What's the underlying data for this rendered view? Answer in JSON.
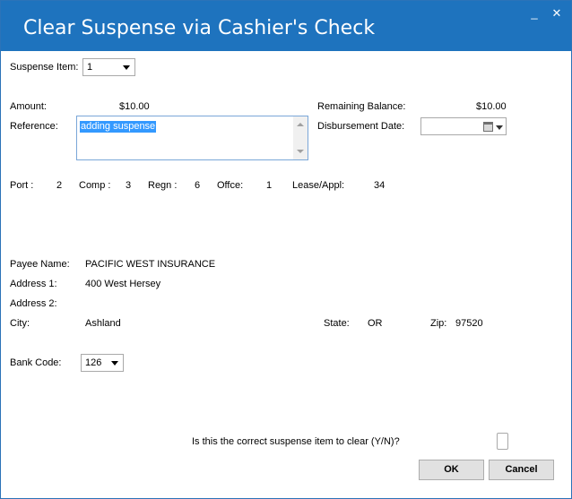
{
  "window": {
    "title": "Clear Suspense via Cashier's Check",
    "minimize_glyph": "_",
    "close_glyph": "✕",
    "titlebar_color": "#1e73be"
  },
  "suspense": {
    "label": "Suspense Item:",
    "value": "1"
  },
  "amount": {
    "label": "Amount:",
    "value": "$10.00"
  },
  "remaining": {
    "label": "Remaining Balance:",
    "value": "$10.00"
  },
  "reference": {
    "label": "Reference:",
    "value": "adding suspense"
  },
  "disbursement": {
    "label": "Disbursement Date:",
    "value": ""
  },
  "codes": {
    "port_label": "Port :",
    "port_value": "2",
    "comp_label": "Comp :",
    "comp_value": "3",
    "regn_label": "Regn :",
    "regn_value": "6",
    "office_label": "Offce:",
    "office_value": "1",
    "lease_label": "Lease/Appl:",
    "lease_value": "34"
  },
  "payee": {
    "name_label": "Payee Name:",
    "name_value": "PACIFIC WEST INSURANCE",
    "addr1_label": "Address 1:",
    "addr1_value": "400 West Hersey",
    "addr2_label": "Address 2:",
    "addr2_value": "",
    "city_label": "City:",
    "city_value": "Ashland",
    "state_label": "State:",
    "state_value": "OR",
    "zip_label": "Zip:",
    "zip_value": "97520"
  },
  "bank": {
    "label": "Bank Code:",
    "value": "126"
  },
  "confirm": {
    "question": "Is this the correct suspense item to clear (Y/N)?",
    "value": ""
  },
  "buttons": {
    "ok": "OK",
    "cancel": "Cancel"
  },
  "icons": {
    "calendar": "calendar-icon",
    "dropdown": "chevron-down-icon"
  }
}
